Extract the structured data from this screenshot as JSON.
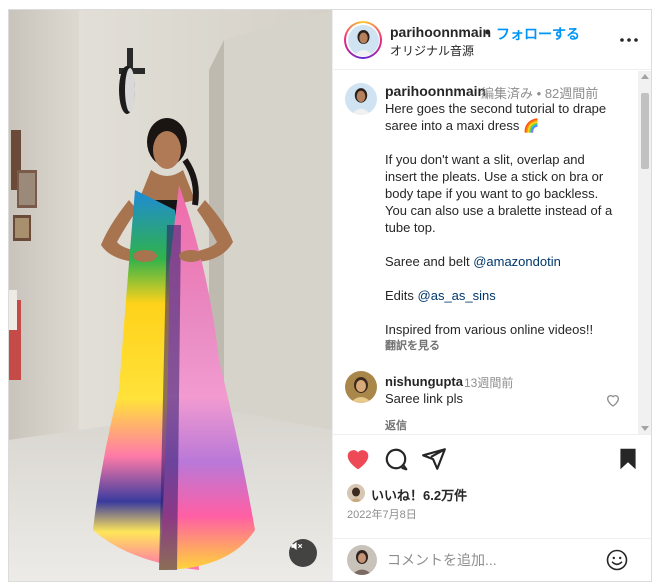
{
  "post": {
    "username": "parihoonnmain",
    "follow_dot": "•",
    "follow_label": "フォローする",
    "audio_label": "オリジナル音源"
  },
  "caption": {
    "username": "parihoonnmain",
    "edited": "編集済み",
    "dot": "•",
    "time": "82週間前",
    "lines": [
      "Here goes the second tutorial to drape",
      "saree into a maxi dress 🌈",
      "",
      "If you don't want a slit, overlap and",
      "insert the pleats. Use a stick on bra or",
      "body tape if you want to go backless.",
      "You can also use a bralette instead of a",
      "tube top.",
      "",
      "Saree and belt ",
      "",
      "Edits ",
      "",
      "Inspired from various online videos!!"
    ],
    "mention_saree": "@amazondotin",
    "mention_edits": "@as_as_sins",
    "translate_label": "翻訳を見る"
  },
  "comment": {
    "username": "nishungupta",
    "time": "13週間前",
    "text": "Saree link pls",
    "reply_label": "返信"
  },
  "stats": {
    "likes": "いいね！6.2万件",
    "date": "2022年7月8日"
  },
  "add_comment": {
    "placeholder": "コメントを追加..."
  },
  "colors": {
    "accent_blue": "#0095f6",
    "like_red": "#ed4956",
    "text": "#262626",
    "muted": "#8e8e8e"
  },
  "icons": {
    "more": "more-horizontal-icon",
    "like": "heart-filled-icon",
    "comment": "comment-bubble-icon",
    "share": "paper-plane-icon",
    "save": "bookmark-filled-icon",
    "mute": "speaker-muted-icon",
    "emoji": "smiley-icon",
    "comment_like": "heart-outline-icon"
  }
}
